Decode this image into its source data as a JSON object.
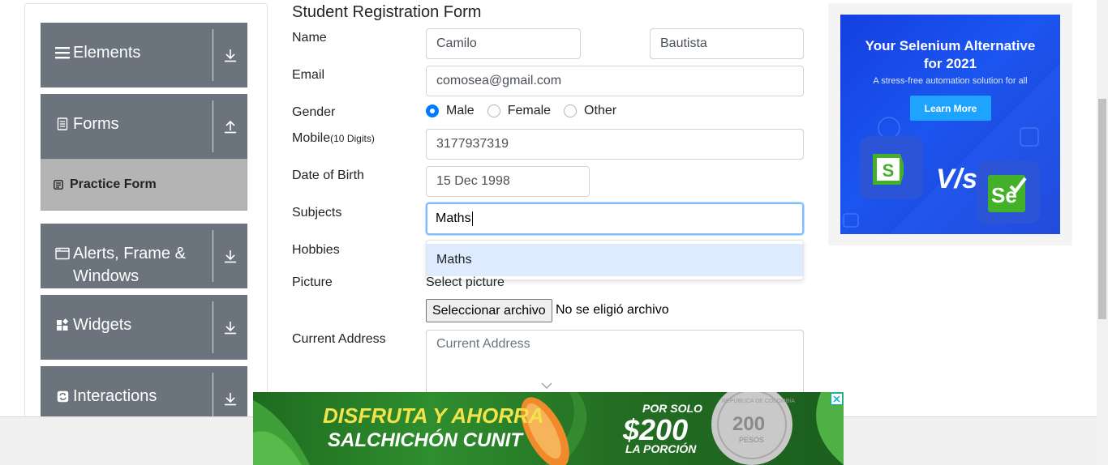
{
  "sidebar": {
    "groups": [
      {
        "label": "Elements",
        "icon": "hamburger-icon",
        "arrow": "download-arrow-icon"
      },
      {
        "label": "Forms",
        "icon": "document-icon",
        "arrow": "upload-arrow-icon"
      },
      {
        "label_line1": "Alerts, Frame &",
        "label_line2": "Windows",
        "icon": "window-icon",
        "arrow": "download-arrow-icon"
      },
      {
        "label": "Widgets",
        "icon": "widgets-icon",
        "arrow": "download-arrow-icon"
      },
      {
        "label": "Interactions",
        "icon": "refresh-icon",
        "arrow": "download-arrow-icon"
      }
    ],
    "active_item": {
      "label": "Practice Form",
      "icon": "form-icon"
    }
  },
  "form": {
    "title": "Student Registration Form",
    "name_label": "Name",
    "first_name": "Camilo",
    "last_name": "Bautista",
    "email_label": "Email",
    "email": "comosea@gmail.com",
    "gender_label": "Gender",
    "gender_options": [
      "Male",
      "Female",
      "Other"
    ],
    "gender_selected": "Male",
    "mobile_label": "Mobile",
    "mobile_hint": "(10 Digits)",
    "mobile": "3177937319",
    "dob_label": "Date of Birth",
    "dob": "15 Dec 1998",
    "subjects_label": "Subjects",
    "subjects_value": "Maths",
    "subjects_suggestion": "Maths",
    "hobbies_label": "Hobbies",
    "picture_label": "Picture",
    "picture_hint": "Select picture",
    "file_button": "Seleccionar archivo",
    "file_status": "No se eligió archivo",
    "address_label": "Current Address",
    "address_placeholder": "Current Address"
  },
  "ad_right": {
    "title_line1": "Your Selenium Alternative",
    "title_line2": "for 2021",
    "subtitle": "A stress-free automation solution for all",
    "button": "Learn More",
    "vs": "V/s",
    "logo_right": "Se",
    "colors": {
      "bg": "#1b4fe8",
      "button": "#1ea3ff",
      "logo_green": "#43b02a"
    }
  },
  "ad_bottom": {
    "line1": "DISFRUTA Y AHORRA",
    "line2": "SALCHICHÓN CUNIT",
    "price_top": "POR SOLO",
    "price": "$200",
    "price_bottom": "LA PORCIÓN",
    "coin_text": "200",
    "coin_sub": "PESOS",
    "coin_ring": "REPUBLICA DE COLOMBIA"
  },
  "colors": {
    "sidebar_bg": "#6b747d",
    "active_item_bg": "#b4b4b4",
    "radio_checked": "#007bff",
    "dropdown_highlight": "#deebff"
  }
}
